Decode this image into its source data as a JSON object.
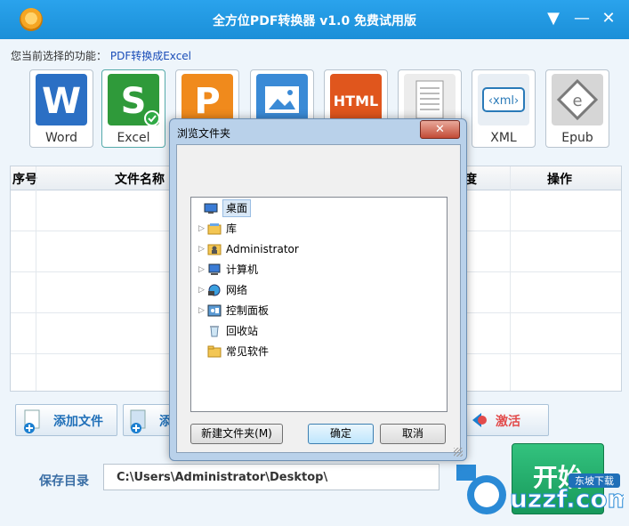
{
  "window": {
    "title": "全方位PDF转换器 v1.0 免费试用版"
  },
  "function_label": {
    "prefix": "您当前选择的功能：",
    "value": "PDF转换成Excel"
  },
  "formats": [
    {
      "label": "Word",
      "color": "#2b6fc4"
    },
    {
      "label": "Excel",
      "color": "#2f9a3a"
    },
    {
      "label": "",
      "color": "#f08a1c"
    },
    {
      "label": "",
      "color": "#3a8ad6"
    },
    {
      "label": "",
      "color": "#e0561d"
    },
    {
      "label": "",
      "color": "#8a8a8a"
    },
    {
      "label": "XML",
      "color": "#2a7ab8"
    },
    {
      "label": "Epub",
      "color": "#7a7a7a"
    }
  ],
  "table": {
    "headers": {
      "index": "序号",
      "name": "文件名称",
      "progress": "度",
      "action": "操作"
    }
  },
  "buttons": {
    "add_file": "添加文件",
    "add_folder": "添",
    "activate": "激活",
    "start": "开始"
  },
  "save": {
    "label": "保存目录",
    "path": "C:\\Users\\Administrator\\Desktop\\"
  },
  "dialog": {
    "title": "浏览文件夹",
    "nodes": [
      {
        "label": "桌面",
        "icon": "desktop-icon"
      },
      {
        "label": "库",
        "icon": "library-icon"
      },
      {
        "label": "Administrator",
        "icon": "user-folder-icon"
      },
      {
        "label": "计算机",
        "icon": "computer-icon"
      },
      {
        "label": "网络",
        "icon": "network-icon"
      },
      {
        "label": "控制面板",
        "icon": "control-panel-icon"
      },
      {
        "label": "回收站",
        "icon": "recycle-bin-icon"
      },
      {
        "label": "常见软件",
        "icon": "folder-icon"
      }
    ],
    "new_folder": "新建文件夹(M)",
    "ok": "确定",
    "cancel": "取消"
  },
  "watermark": {
    "text": "uzzf.com",
    "badge": "东坡下载"
  }
}
